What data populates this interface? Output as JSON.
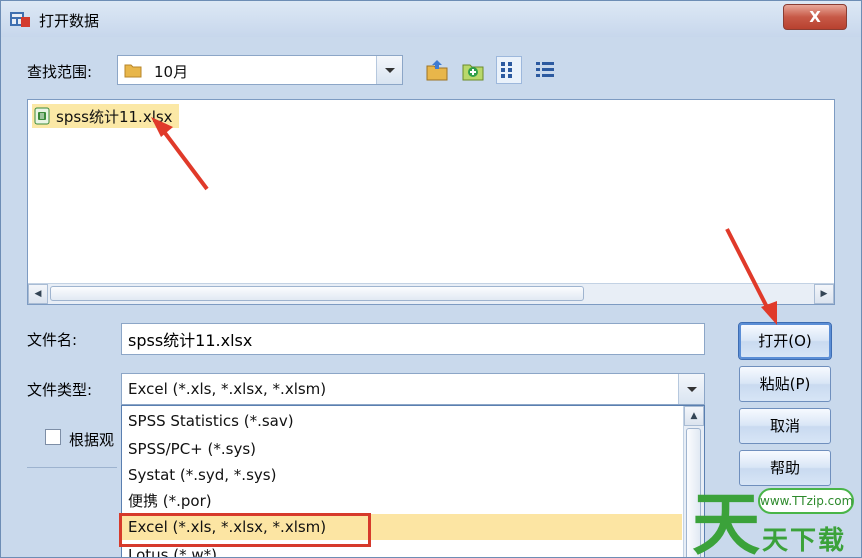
{
  "window": {
    "title": "打开数据",
    "close_label": "X"
  },
  "lookin": {
    "label": "查找范围:",
    "value": "10月"
  },
  "toolbar": {
    "icons": [
      "up-folder-icon",
      "new-folder-icon",
      "list-view-icon",
      "details-view-icon"
    ]
  },
  "file_list": {
    "items": [
      {
        "name": "spss统计11.xlsx",
        "icon": "spreadsheet-file-icon",
        "selected": true
      }
    ]
  },
  "filename": {
    "label": "文件名:",
    "value": "spss统计11.xlsx"
  },
  "filetype": {
    "label": "文件类型:",
    "value": "Excel (*.xls, *.xlsx, *.xlsm)",
    "options": [
      "SPSS Statistics (*.sav)",
      "SPSS/PC+ (*.sys)",
      "Systat (*.syd, *.sys)",
      "便携 (*.por)",
      "Excel (*.xls, *.xlsx, *.xlsm)",
      "Lotus (*.w*)"
    ],
    "selected_index": 4
  },
  "checkbox": {
    "label": "根据观"
  },
  "buttons": {
    "open": "打开(O)",
    "paste": "粘贴(P)",
    "cancel": "取消",
    "help": "帮助"
  },
  "watermark": {
    "url": "www.TTzip.com",
    "big_char": "天",
    "chars": "天下载"
  },
  "colors": {
    "annotation_red": "#d63a2b",
    "selection_yellow": "#fce5a3",
    "brand_green": "#3ba23a"
  }
}
